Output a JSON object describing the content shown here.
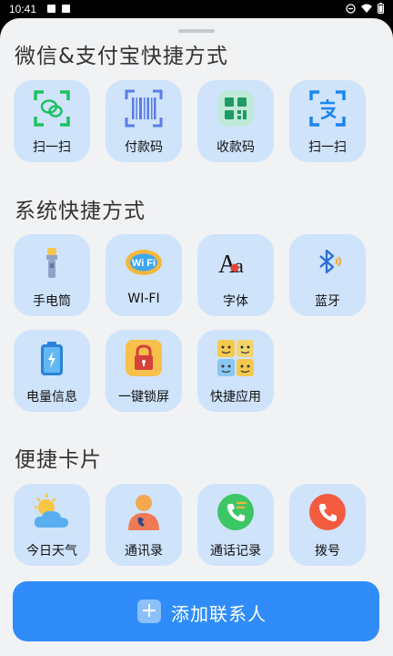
{
  "status_bar": {
    "time": "10:41"
  },
  "sections": {
    "wechat_alipay": {
      "title": "微信&支付宝快捷方式",
      "items": [
        {
          "label": "扫一扫",
          "icon": "wechat-scan-icon"
        },
        {
          "label": "付款码",
          "icon": "barcode-icon"
        },
        {
          "label": "收款码",
          "icon": "qrcode-icon"
        },
        {
          "label": "扫一扫",
          "icon": "alipay-scan-icon"
        }
      ]
    },
    "system": {
      "title": "系统快捷方式",
      "items": [
        {
          "label": "手电筒",
          "icon": "flashlight-icon"
        },
        {
          "label": "WI-FI",
          "icon": "wifi-icon"
        },
        {
          "label": "字体",
          "icon": "font-icon"
        },
        {
          "label": "蓝牙",
          "icon": "bluetooth-icon"
        },
        {
          "label": "电量信息",
          "icon": "battery-icon"
        },
        {
          "label": "一键锁屏",
          "icon": "lock-icon"
        },
        {
          "label": "快捷应用",
          "icon": "emoji-apps-icon"
        }
      ]
    },
    "cards": {
      "title": "便捷卡片",
      "items": [
        {
          "label": "今日天气",
          "icon": "weather-icon"
        },
        {
          "label": "通讯录",
          "icon": "contacts-icon"
        },
        {
          "label": "通话记录",
          "icon": "call-log-icon"
        },
        {
          "label": "拨号",
          "icon": "dial-icon"
        }
      ]
    }
  },
  "add_contact": {
    "label": "添加联系人",
    "icon": "plus-icon"
  },
  "colors": {
    "accent": "#2f8cf8",
    "tile_bg": "#cfe3fb",
    "sheet_bg": "#f1f2f4"
  }
}
